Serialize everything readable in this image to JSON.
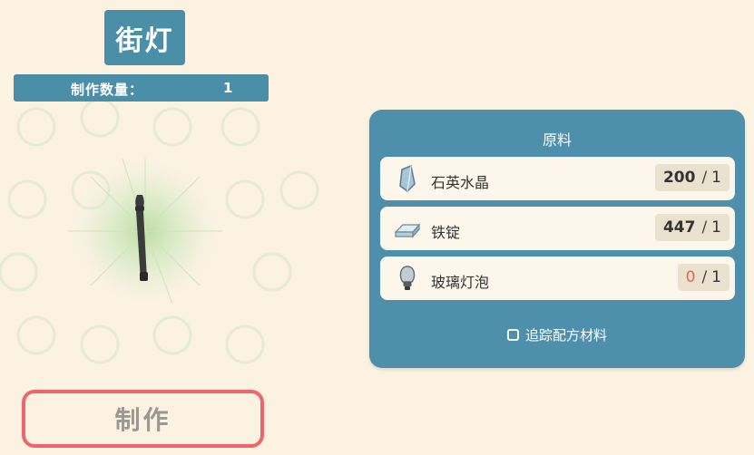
{
  "item": {
    "title": "街灯"
  },
  "quantity": {
    "label": "制作数量：",
    "value": "1"
  },
  "craft_button": {
    "label": "制作"
  },
  "materials_panel": {
    "title": "原料",
    "items": [
      {
        "name": "石英水晶",
        "have": "200",
        "separator": "/",
        "need": "1",
        "icon": "quartz-crystal-icon"
      },
      {
        "name": "铁锭",
        "have": "447",
        "separator": "/",
        "need": "1",
        "icon": "iron-ingot-icon"
      },
      {
        "name": "玻璃灯泡",
        "have": "0",
        "separator": "/",
        "need": "1",
        "icon": "glass-bulb-icon"
      }
    ],
    "track_label": "追踪配方材料"
  },
  "colors": {
    "panel": "#4e8fab",
    "header": "#4a8ea8",
    "background": "#fbf2e2",
    "craft_border": "#f0656b",
    "insufficient": "#e8664f"
  }
}
